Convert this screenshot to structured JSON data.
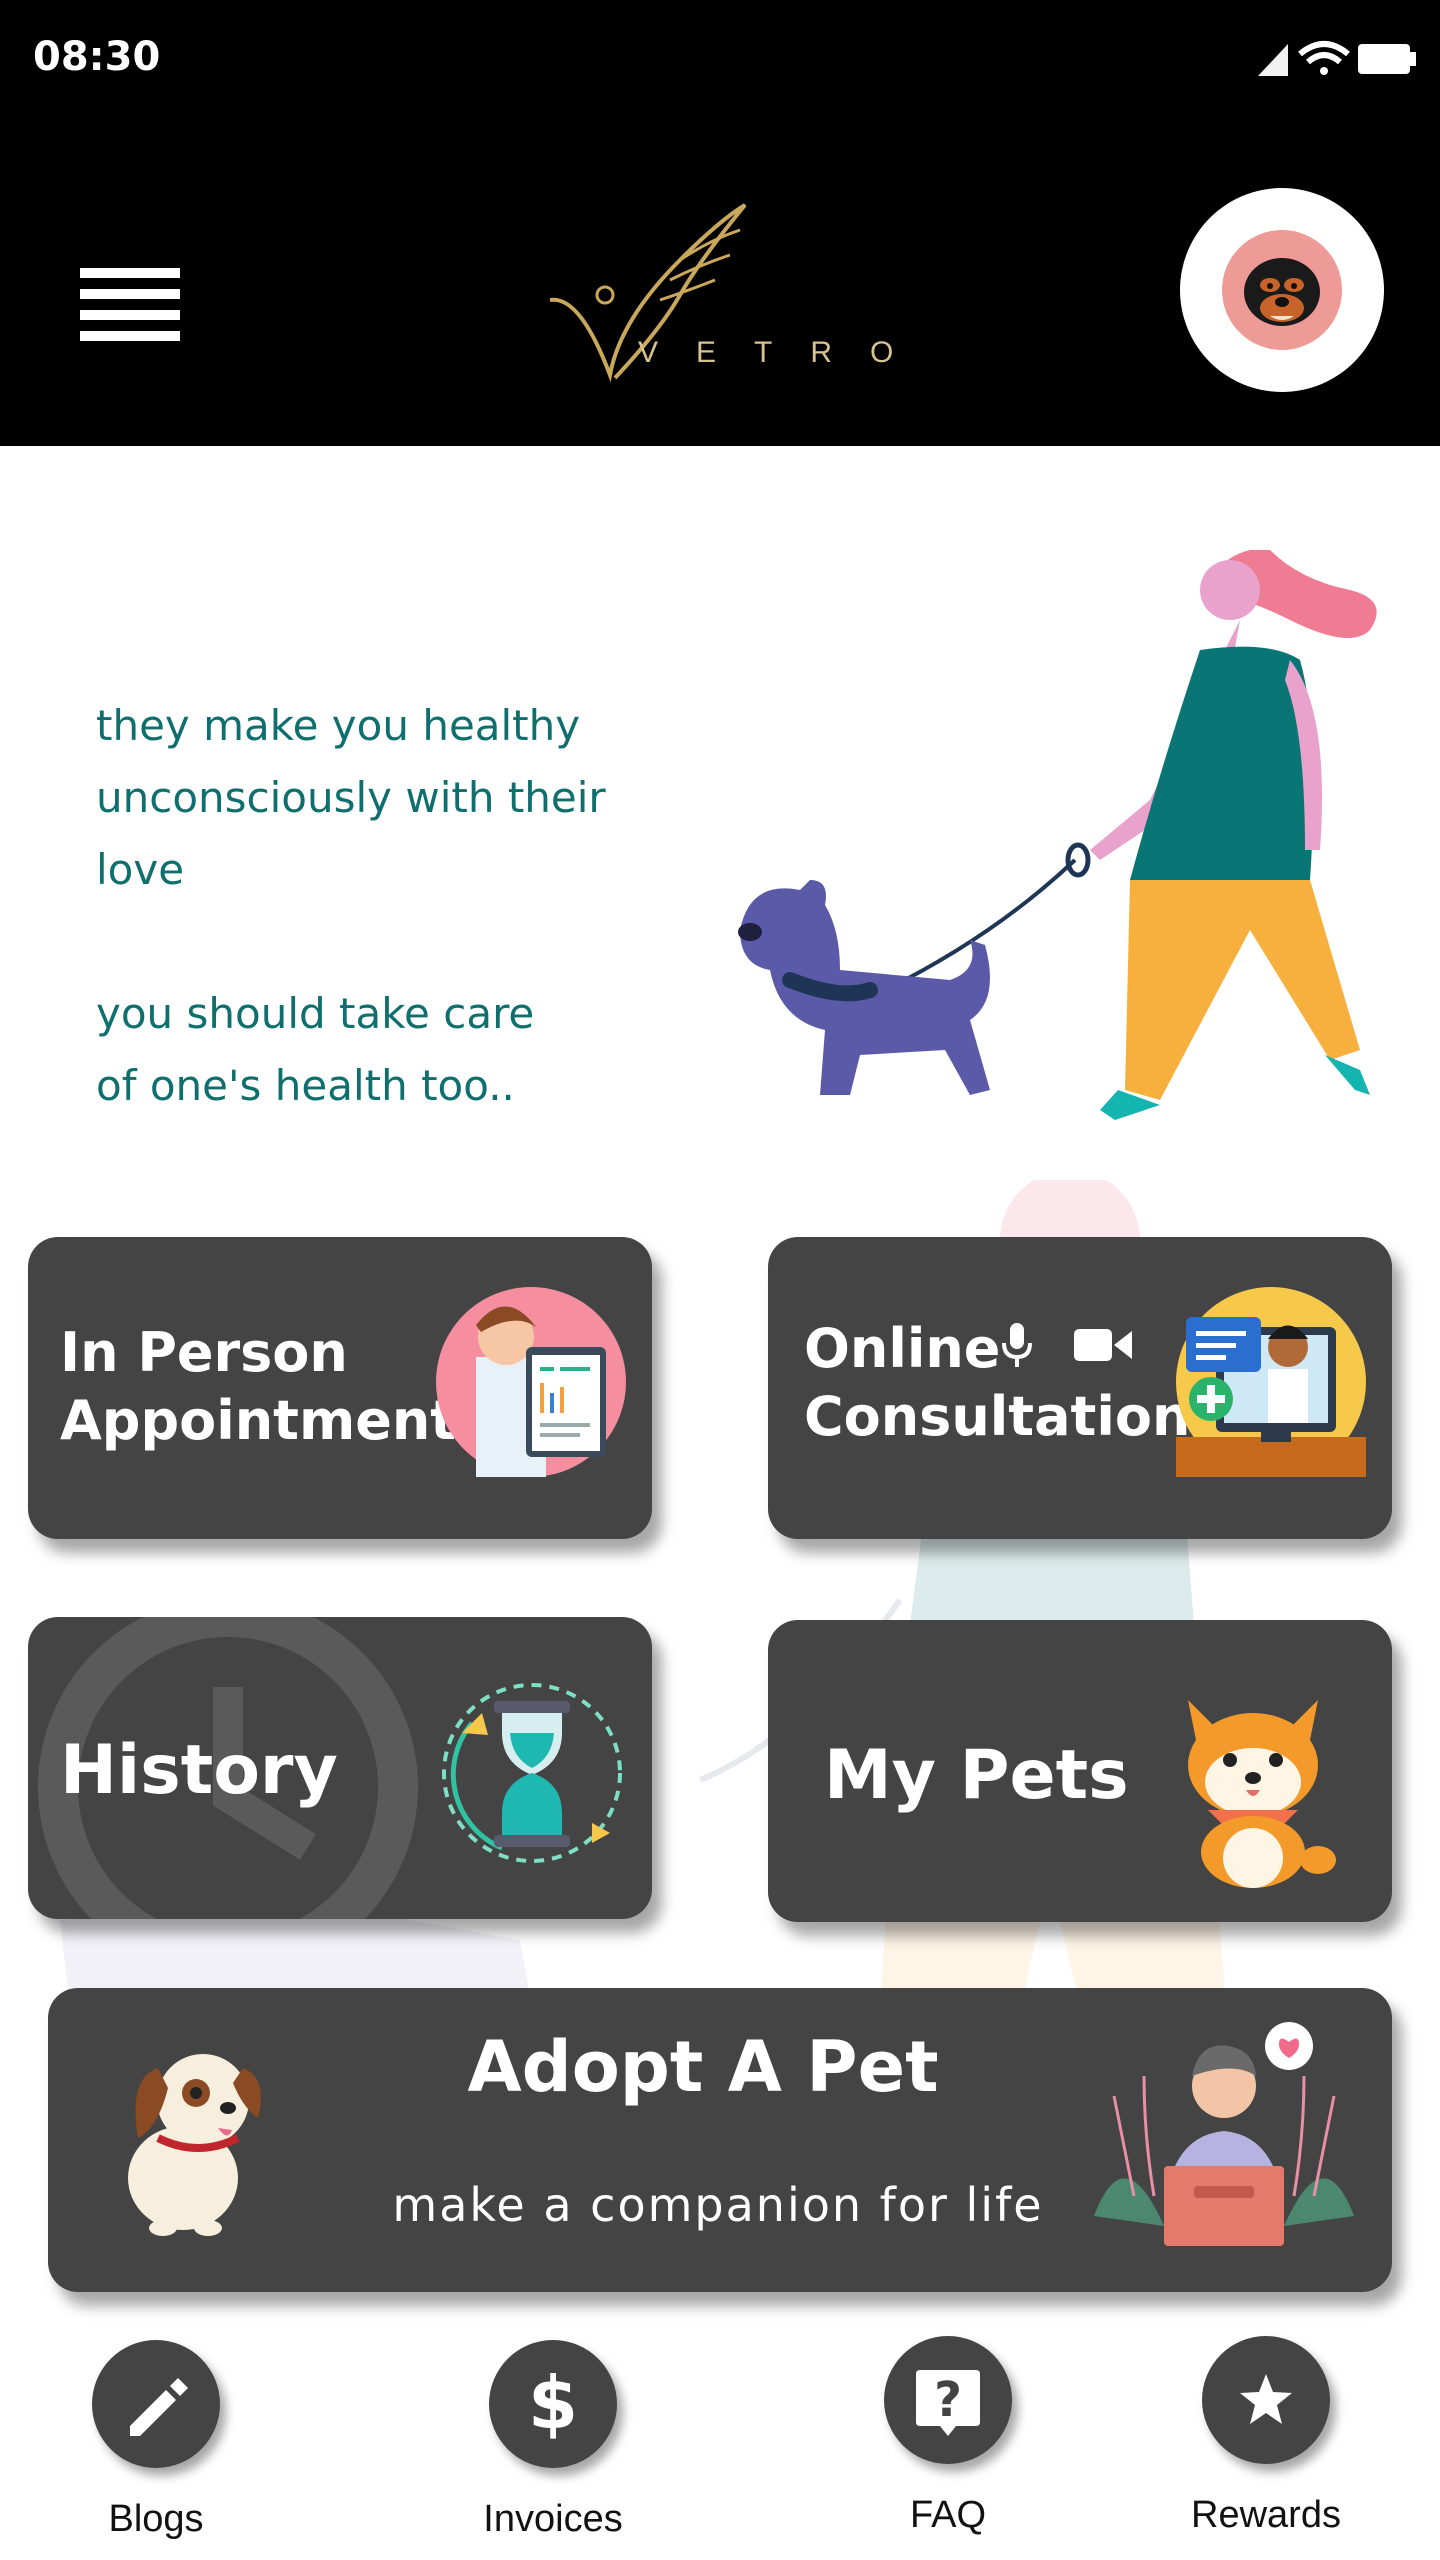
{
  "status_bar": {
    "time": "08:30"
  },
  "header": {
    "logo_text": "VETRO"
  },
  "hero": {
    "lines": [
      "they make you healthy",
      "unconsciously with their love",
      "",
      "you should take care",
      "of one's health too.."
    ]
  },
  "cards": {
    "in_person": {
      "line1": "In Person",
      "line2": "Appointment"
    },
    "online": {
      "line1": "Online",
      "line2": "Consultation"
    },
    "history": {
      "title": "History"
    },
    "my_pets": {
      "title": "My Pets"
    },
    "adopt": {
      "title": "Adopt A Pet",
      "subtitle": "make a companion for life"
    }
  },
  "bottom_nav": [
    {
      "label": "Blogs",
      "icon": "pencil-icon"
    },
    {
      "label": "Invoices",
      "icon": "dollar-icon"
    },
    {
      "label": "FAQ",
      "icon": "question-icon"
    },
    {
      "label": "Rewards",
      "icon": "star-icon"
    }
  ],
  "colors": {
    "header_bg": "#000000",
    "card_bg": "#444444",
    "hero_text": "#0f6f6f",
    "logo_gold": "#c9a85c"
  }
}
